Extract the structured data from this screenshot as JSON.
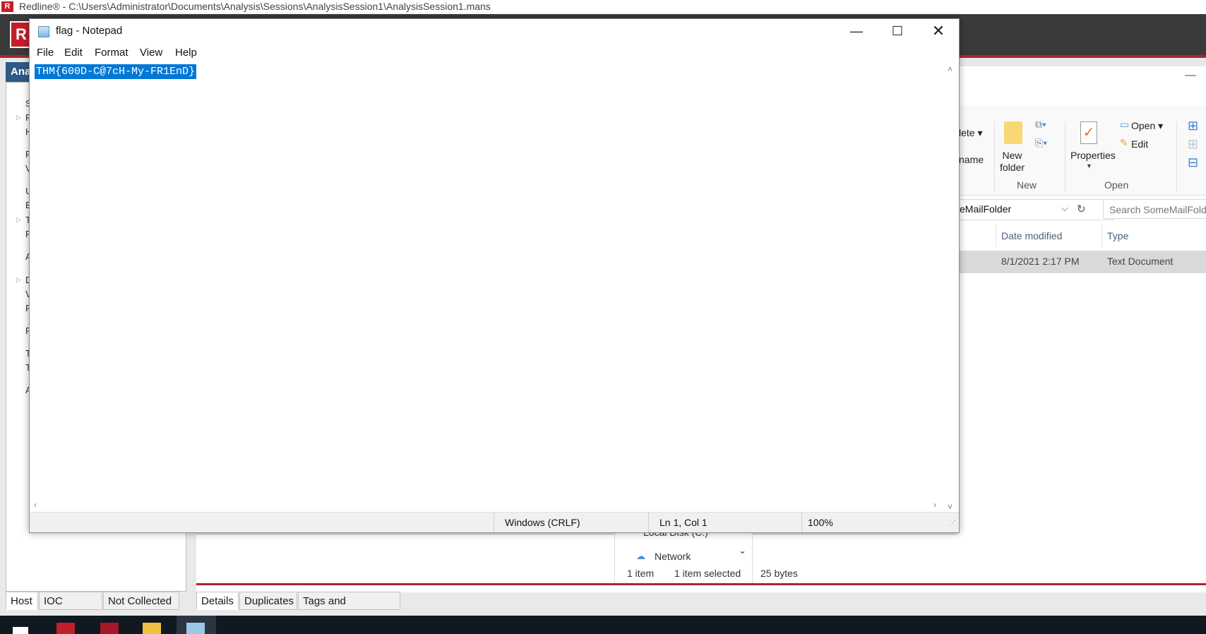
{
  "redline": {
    "title": "Redline® - C:\\Users\\Administrator\\Documents\\Analysis\\Sessions\\AnalysisSession1\\AnalysisSession1.mans",
    "logo_text": "R",
    "left_header": "Ana",
    "tree_fragments": [
      "S",
      "F",
      "H",
      "F",
      "V",
      "U",
      "E",
      "T",
      "F",
      "A",
      "D",
      "V",
      "F",
      "F",
      "T",
      "T",
      "A"
    ],
    "bottom_tabs_left": [
      "Host",
      "IOC Reports",
      "Not Collected"
    ],
    "bottom_tabs_right": [
      "Details",
      "Duplicates",
      "Tags and Comments"
    ],
    "accent": "#b0242f"
  },
  "explorer": {
    "ribbon": {
      "delete": "lete ▾",
      "rename": "name",
      "new_folder": "New\nfolder",
      "properties": "Properties",
      "open": "Open ▾",
      "edit": "Edit",
      "group_new": "New",
      "group_open": "Open"
    },
    "address": "eMailFolder",
    "search_placeholder": "Search SomeMailFolder",
    "columns": [
      "Date modified",
      "Type"
    ],
    "file": {
      "date": "8/1/2021 2:17 PM",
      "type": "Text Document"
    },
    "nav": {
      "local_disk": "Local Disk (C:)",
      "network": "Network"
    },
    "status": {
      "items": "1 item",
      "selected": "1 item selected",
      "size": "25 bytes"
    }
  },
  "notepad": {
    "title": "flag - Notepad",
    "menu": [
      "File",
      "Edit",
      "Format",
      "View",
      "Help"
    ],
    "content": "THM{600D-C@7cH-My-FR1EnD}",
    "status": {
      "line_ending": "Windows (CRLF)",
      "position": "Ln 1, Col 1",
      "zoom": "100%"
    },
    "selection_color": "#0078d7"
  }
}
